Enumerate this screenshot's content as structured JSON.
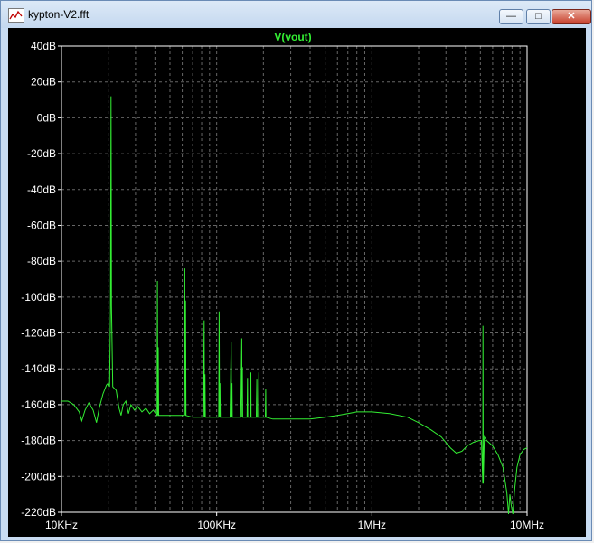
{
  "window": {
    "title": "kypton-V2.fft",
    "buttons": {
      "minimize": "—",
      "maximize": "□",
      "close": "✕"
    }
  },
  "colors": {
    "trace": "#33ee33",
    "grid": "#666666",
    "axis_text": "#ffffff",
    "background": "#000000"
  },
  "chart_data": {
    "type": "line",
    "title": "V(vout)",
    "xlabel": "",
    "ylabel": "",
    "x_scale": "log",
    "xlim": [
      10000,
      10000000
    ],
    "ylim": [
      -220,
      40
    ],
    "grid": true,
    "x_ticks": [
      {
        "value": 10000,
        "label": "10KHz"
      },
      {
        "value": 100000,
        "label": "100KHz"
      },
      {
        "value": 1000000,
        "label": "1MHz"
      },
      {
        "value": 10000000,
        "label": "10MHz"
      }
    ],
    "y_ticks": [
      {
        "value": 40,
        "label": "40dB"
      },
      {
        "value": 20,
        "label": "20dB"
      },
      {
        "value": 0,
        "label": "0dB"
      },
      {
        "value": -20,
        "label": "-20dB"
      },
      {
        "value": -40,
        "label": "-40dB"
      },
      {
        "value": -60,
        "label": "-60dB"
      },
      {
        "value": -80,
        "label": "-80dB"
      },
      {
        "value": -100,
        "label": "-100dB"
      },
      {
        "value": -120,
        "label": "-120dB"
      },
      {
        "value": -140,
        "label": "-140dB"
      },
      {
        "value": -160,
        "label": "-160dB"
      },
      {
        "value": -180,
        "label": "-180dB"
      },
      {
        "value": -200,
        "label": "-200dB"
      },
      {
        "value": -220,
        "label": "-220dB"
      }
    ],
    "series": [
      {
        "points": [
          [
            10000,
            -158
          ],
          [
            11000,
            -158
          ],
          [
            12000,
            -160
          ],
          [
            13000,
            -164
          ],
          [
            13500,
            -169
          ],
          [
            14200,
            -163
          ],
          [
            15000,
            -159
          ],
          [
            16000,
            -163
          ],
          [
            16800,
            -170
          ],
          [
            17500,
            -162
          ],
          [
            18500,
            -154
          ],
          [
            19500,
            -149
          ],
          [
            20000,
            -148
          ],
          [
            20400,
            -150
          ],
          [
            20700,
            -108
          ],
          [
            20800,
            -28
          ],
          [
            20850,
            12
          ],
          [
            20900,
            -30
          ],
          [
            21000,
            -105
          ],
          [
            21400,
            -150
          ],
          [
            22500,
            -152
          ],
          [
            23500,
            -162
          ],
          [
            24200,
            -166
          ],
          [
            25000,
            -160
          ],
          [
            26000,
            -158
          ],
          [
            27000,
            -165
          ],
          [
            28000,
            -160
          ],
          [
            29500,
            -163
          ],
          [
            31000,
            -161
          ],
          [
            33000,
            -164
          ],
          [
            35000,
            -162
          ],
          [
            37000,
            -165
          ],
          [
            39000,
            -163
          ],
          [
            40500,
            -165
          ],
          [
            41300,
            -166
          ],
          [
            41500,
            -91
          ],
          [
            41700,
            -166
          ],
          [
            42000,
            -128
          ],
          [
            42300,
            -166
          ],
          [
            46000,
            -166
          ],
          [
            52000,
            -166
          ],
          [
            58000,
            -166
          ],
          [
            61500,
            -166
          ],
          [
            62300,
            -84
          ],
          [
            62600,
            -166
          ],
          [
            63000,
            -102
          ],
          [
            63400,
            -166
          ],
          [
            70000,
            -167
          ],
          [
            78000,
            -167
          ],
          [
            82000,
            -167
          ],
          [
            83000,
            -113
          ],
          [
            83400,
            -167
          ],
          [
            84000,
            -143
          ],
          [
            84500,
            -167
          ],
          [
            95000,
            -167
          ],
          [
            103000,
            -167
          ],
          [
            103800,
            -108
          ],
          [
            104300,
            -167
          ],
          [
            105000,
            -148
          ],
          [
            105500,
            -167
          ],
          [
            122000,
            -167
          ],
          [
            124000,
            -125
          ],
          [
            124600,
            -167
          ],
          [
            125500,
            -148
          ],
          [
            126000,
            -167
          ],
          [
            143000,
            -167
          ],
          [
            145000,
            -123
          ],
          [
            145600,
            -167
          ],
          [
            146500,
            -139
          ],
          [
            147000,
            -167
          ],
          [
            157000,
            -167
          ],
          [
            158000,
            -145
          ],
          [
            158600,
            -167
          ],
          [
            165000,
            -167
          ],
          [
            166000,
            -142
          ],
          [
            166600,
            -167
          ],
          [
            180000,
            -167
          ],
          [
            181500,
            -146
          ],
          [
            182200,
            -167
          ],
          [
            186000,
            -167
          ],
          [
            187000,
            -142
          ],
          [
            187700,
            -167
          ],
          [
            206000,
            -167
          ],
          [
            207000,
            -151
          ],
          [
            207700,
            -167
          ],
          [
            230000,
            -168
          ],
          [
            250000,
            -168
          ],
          [
            300000,
            -168
          ],
          [
            400000,
            -168
          ],
          [
            500000,
            -167
          ],
          [
            600000,
            -166
          ],
          [
            700000,
            -165
          ],
          [
            800000,
            -164
          ],
          [
            1000000,
            -164
          ],
          [
            1300000,
            -165
          ],
          [
            1700000,
            -167
          ],
          [
            2000000,
            -170
          ],
          [
            2400000,
            -174
          ],
          [
            2800000,
            -178
          ],
          [
            3200000,
            -184
          ],
          [
            3500000,
            -187
          ],
          [
            3800000,
            -186
          ],
          [
            4100000,
            -183
          ],
          [
            4500000,
            -181
          ],
          [
            4900000,
            -180
          ],
          [
            5080000,
            -180
          ],
          [
            5180000,
            -204
          ],
          [
            5200000,
            -116
          ],
          [
            5220000,
            -204
          ],
          [
            5300000,
            -178
          ],
          [
            5500000,
            -180
          ],
          [
            6000000,
            -183
          ],
          [
            6500000,
            -188
          ],
          [
            7000000,
            -195
          ],
          [
            7400000,
            -209
          ],
          [
            7600000,
            -221
          ],
          [
            7750000,
            -210
          ],
          [
            7900000,
            -216
          ],
          [
            8100000,
            -221
          ],
          [
            8300000,
            -208
          ],
          [
            8600000,
            -195
          ],
          [
            9000000,
            -188
          ],
          [
            9500000,
            -185
          ],
          [
            10000000,
            -184
          ]
        ]
      }
    ]
  }
}
